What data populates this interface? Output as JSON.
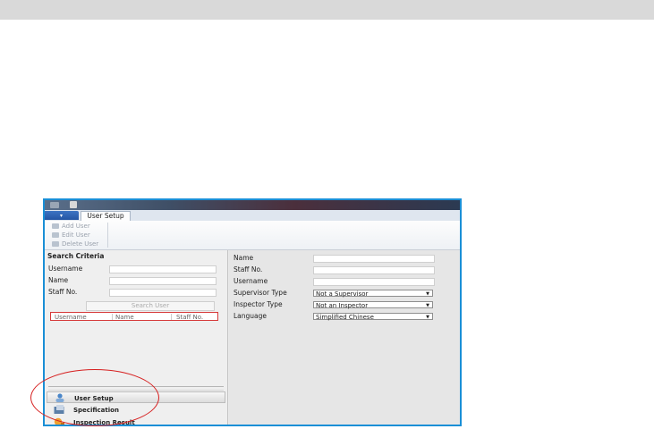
{
  "app": {
    "title_text": "",
    "user_setup_tab": "User Setup"
  },
  "ribbon": {
    "add_user": "Add User",
    "edit_user": "Edit User",
    "delete_user": "Delete User"
  },
  "search": {
    "header": "Search Criteria",
    "username_label": "Username",
    "name_label": "Name",
    "staff_label": "Staff No.",
    "button": "Search User",
    "columns": [
      "Username",
      "Name",
      "Staff No."
    ]
  },
  "nav": {
    "items": [
      "User Setup",
      "Specification",
      "Inspection Result"
    ]
  },
  "form": {
    "name_label": "Name",
    "staff_label": "Staff No.",
    "username_label": "Username",
    "supervisor_label": "Supervisor Type",
    "supervisor_value": "Not a Supervisor",
    "inspector_label": "Inspector Type",
    "inspector_value": "Not an Inspector",
    "language_label": "Language",
    "language_value": "Simplified Chinese"
  },
  "colors": {
    "frame": "#1a8fd6",
    "annotation": "#d62020",
    "ribbon_blue": "#2455a3"
  }
}
